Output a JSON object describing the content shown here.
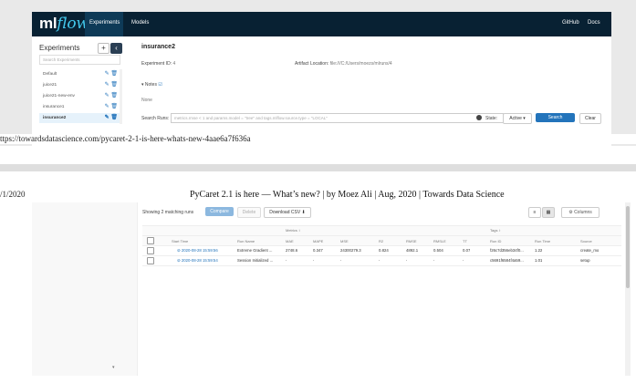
{
  "navbar": {
    "logo_ml": "ml",
    "logo_flow": "flow",
    "tab_experiments": "Experiments",
    "tab_models": "Models",
    "github": "GitHub",
    "docs": "Docs"
  },
  "sidebar": {
    "title": "Experiments",
    "add": "+",
    "collapse": "‹",
    "search_placeholder": "Search Experiments",
    "items": [
      {
        "label": "Default"
      },
      {
        "label": "juice21"
      },
      {
        "label": "juice21-new-env"
      },
      {
        "label": "insurance1"
      },
      {
        "label": "insurance2"
      }
    ]
  },
  "experiment": {
    "name": "insurance2",
    "id_label": "Experiment ID:",
    "id_value": "4",
    "artifact_label": "Artifact Location:",
    "artifact_value": "file:///C:/Users/moezs/mlruns/4",
    "notes_label": "Notes",
    "notes_value": "None"
  },
  "search": {
    "label": "Search Runs:",
    "placeholder": "metrics.rmse < 1 and params.model = \"tree\" and tags.mlflow.source.type = \"LOCAL\"",
    "state_label": "State:",
    "state_value": "Active",
    "search_button": "Search",
    "clear_button": "Clear"
  },
  "url_text": "ttps://towardsdatascience.com/pycaret-2-1-is-here-whats-new-4aae6a7f636a",
  "date_text": "/1/2020",
  "article_title": "PyCaret 2.1 is here — What’s new? | by Moez Ali | Aug, 2020 | Towards Data Science",
  "runs": {
    "showing": "Showing 2 matching runs",
    "compare": "Compare",
    "delete": "Delete",
    "download": "Download CSV",
    "columns": "Columns",
    "group_metrics": "Metrics",
    "group_tags": "Tags",
    "headers": [
      "Start Time",
      "Run Name",
      "MAE",
      "MAPE",
      "MSE",
      "R2",
      "RMSE",
      "RMSLE",
      "TT",
      "Run ID",
      "Run Time",
      "Source"
    ],
    "rows": [
      [
        "2020-08-28 15:59:56",
        "Extreme Gradient ...",
        "2748.6",
        "0.347",
        "24300279.3",
        "0.824",
        "4892.1",
        "0.504",
        "0.07",
        "f26c7d356eb34f0...",
        "1.22",
        "create_mo"
      ],
      [
        "2020-08-28 15:59:54",
        "Session Initialized ...",
        "-",
        "-",
        "-",
        "-",
        "-",
        "-",
        "-",
        "c5691f6584f4a59...",
        "1.01",
        "setup"
      ]
    ]
  }
}
